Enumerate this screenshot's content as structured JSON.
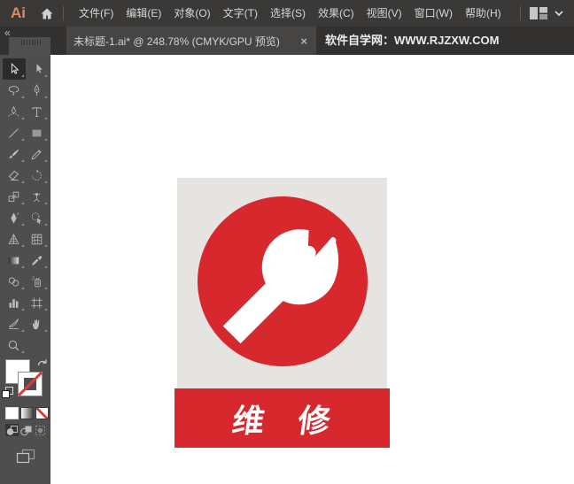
{
  "app": {
    "logo_text": "Ai",
    "menu_items": [
      {
        "id": "file",
        "label": "文件(F)"
      },
      {
        "id": "edit",
        "label": "编辑(E)"
      },
      {
        "id": "object",
        "label": "对象(O)"
      },
      {
        "id": "type",
        "label": "文字(T)"
      },
      {
        "id": "select",
        "label": "选择(S)"
      },
      {
        "id": "effect",
        "label": "效果(C)"
      },
      {
        "id": "view",
        "label": "视图(V)"
      },
      {
        "id": "window",
        "label": "窗口(W)"
      },
      {
        "id": "help",
        "label": "帮助(H)"
      }
    ],
    "icons": [
      "home-icon",
      "workspace-layout-icon",
      "chevron-down-icon"
    ]
  },
  "tab_bar": {
    "collapse_glyph": "«",
    "document_tab": {
      "title": "未标题-1.ai* @ 248.78% (CMYK/GPU 预览)",
      "close_glyph": "×"
    },
    "site_text": "软件自学网：WWW.RJZXW.COM"
  },
  "toolbar": {
    "tools": [
      {
        "name": "selection",
        "selected": true
      },
      {
        "name": "direct-selection"
      },
      {
        "name": "lasso"
      },
      {
        "name": "pen"
      },
      {
        "name": "curvature"
      },
      {
        "name": "type"
      },
      {
        "name": "line-segment"
      },
      {
        "name": "rectangle"
      },
      {
        "name": "paintbrush"
      },
      {
        "name": "pencil"
      },
      {
        "name": "eraser"
      },
      {
        "name": "rotate"
      },
      {
        "name": "scale"
      },
      {
        "name": "puppet-warp"
      },
      {
        "name": "shape-builder"
      },
      {
        "name": "live-paint-selection"
      },
      {
        "name": "perspective-grid"
      },
      {
        "name": "mesh"
      },
      {
        "name": "gradient"
      },
      {
        "name": "eyedropper"
      },
      {
        "name": "blend"
      },
      {
        "name": "symbol-sprayer"
      },
      {
        "name": "column-graph"
      },
      {
        "name": "artboard"
      },
      {
        "name": "slice"
      },
      {
        "name": "hand"
      },
      {
        "name": "zoom"
      }
    ],
    "color_controls": [
      "fill-color-swatch",
      "stroke-color-swatch",
      "swap-fill-stroke-icon",
      "default-fill-stroke-icon",
      "color-button",
      "gradient-button",
      "none-button",
      "draw-normal-button",
      "draw-behind-button",
      "draw-inside-button",
      "change-screen-mode-button"
    ]
  },
  "artwork": {
    "sign_label": "维 修",
    "colors": {
      "red": "#d7282d",
      "sign_gray": "#e6e4e1",
      "white": "#ffffff"
    }
  }
}
